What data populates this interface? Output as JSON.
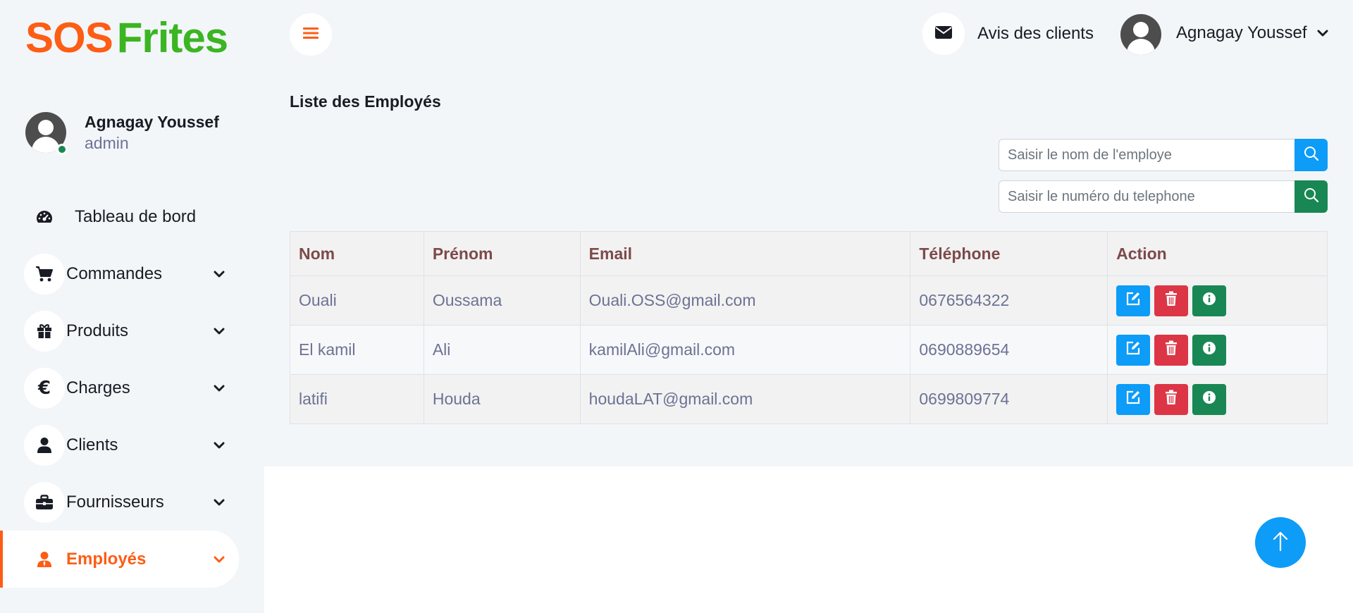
{
  "brand": {
    "part1": "SOS",
    "part2": "Frites"
  },
  "profile": {
    "name": "Agnagay Youssef",
    "role": "admin"
  },
  "sidebar": {
    "items": [
      {
        "label": "Tableau de bord",
        "icon": "dashboard-icon"
      },
      {
        "label": "Commandes",
        "icon": "cart-icon"
      },
      {
        "label": "Produits",
        "icon": "gift-icon"
      },
      {
        "label": "Charges",
        "icon": "euro-icon"
      },
      {
        "label": "Clients",
        "icon": "user-icon"
      },
      {
        "label": "Fournisseurs",
        "icon": "briefcase-icon"
      },
      {
        "label": "Employés",
        "icon": "employee-icon",
        "active": true
      }
    ]
  },
  "topbar": {
    "reviews_label": "Avis des clients",
    "user_name": "Agnagay Youssef"
  },
  "page": {
    "title": "Liste des Employés"
  },
  "search": {
    "name_placeholder": "Saisir le nom de l'employe",
    "phone_placeholder": "Saisir le numéro du telephone"
  },
  "table": {
    "headers": [
      "Nom",
      "Prénom",
      "Email",
      "Téléphone",
      "Action"
    ],
    "rows": [
      {
        "nom": "Ouali",
        "prenom": "Oussama",
        "email": "Ouali.OSS@gmail.com",
        "telephone": "0676564322"
      },
      {
        "nom": "El kamil",
        "prenom": "Ali",
        "email": "kamilAli@gmail.com",
        "telephone": "0690889654"
      },
      {
        "nom": "latifi",
        "prenom": "Houda",
        "email": "houdaLAT@gmail.com",
        "telephone": "0699809774"
      }
    ]
  },
  "colors": {
    "brand_orange": "#fd5d14",
    "brand_green": "#3bb522",
    "primary_blue": "#0d9cf7",
    "danger_red": "#dc3545",
    "success_green": "#198754"
  }
}
